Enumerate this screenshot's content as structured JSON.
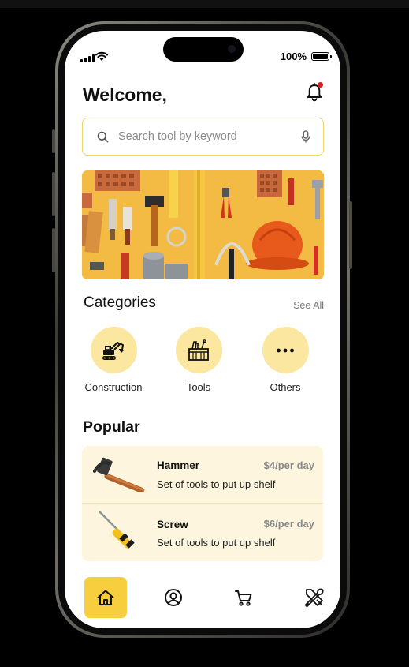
{
  "status_bar": {
    "battery": "100%"
  },
  "header": {
    "greeting": "Welcome,"
  },
  "search": {
    "placeholder": "Search tool by keyword"
  },
  "categories": {
    "title": "Categories",
    "see_all": "See All",
    "items": [
      {
        "label": "Construction",
        "icon": "excavator-icon"
      },
      {
        "label": "Tools",
        "icon": "toolbox-icon"
      },
      {
        "label": "Others",
        "icon": "more-dots-icon"
      }
    ]
  },
  "popular": {
    "title": "Popular",
    "items": [
      {
        "name": "Hammer",
        "price": "$4/per day",
        "description": "Set of tools to put up shelf",
        "icon": "hammer-icon"
      },
      {
        "name": "Screw",
        "price": "$6/per day",
        "description": "Set of tools to put up shelf",
        "icon": "screwdriver-icon"
      }
    ]
  },
  "bottom_nav": {
    "items": [
      {
        "icon": "home-icon",
        "active": true
      },
      {
        "icon": "profile-icon",
        "active": false
      },
      {
        "icon": "cart-icon",
        "active": false
      },
      {
        "icon": "tools-icon",
        "active": false
      }
    ]
  },
  "colors": {
    "accent": "#f7cf3e",
    "accent_light": "#fbe7a0",
    "card_bg": "#fdf5dd",
    "notification": "#e01b1b"
  }
}
